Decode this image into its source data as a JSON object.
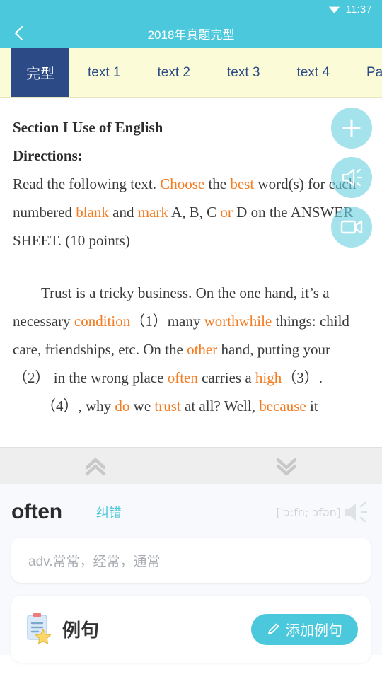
{
  "status_bar": {
    "time": "11:37",
    "wifi_icon": "wifi-icon"
  },
  "app_bar": {
    "back_icon": "back-chevron-icon",
    "title": "2018年真题完型"
  },
  "tabs": [
    {
      "label": "完型",
      "active": true
    },
    {
      "label": "text 1",
      "active": false
    },
    {
      "label": "text 2",
      "active": false
    },
    {
      "label": "text 3",
      "active": false
    },
    {
      "label": "text 4",
      "active": false
    },
    {
      "label": "Part I",
      "active": false
    }
  ],
  "fabs": [
    {
      "name": "add-button",
      "icon": "plus-icon"
    },
    {
      "name": "audio-button",
      "icon": "speaker-icon"
    },
    {
      "name": "video-button",
      "icon": "video-camera-icon"
    }
  ],
  "reader": {
    "section_title": "Section I  Use of English",
    "directions_label": "Directions:",
    "directions_line1_a": "Read the following text. ",
    "directions_choose": "Choose",
    "directions_line1_b": " the ",
    "directions_best": "best",
    "directions_line1_c": " word(s) for",
    "directions_line2_a": "each numbered ",
    "directions_blank": "blank",
    "directions_line2_b": " and ",
    "directions_mark": "mark",
    "directions_line2_c": " A, B, C ",
    "directions_or": "or",
    "directions_line2_d": " D on the",
    "directions_line3": "ANSWER SHEET. (10 points)",
    "para1_a": "Trust is a tricky business. On the one hand, it’s a necessary ",
    "para1_condition": "condition",
    "para1_b": "（1）many ",
    "para1_worthwhile": "worthwhile",
    "para1_c": " things: child care, friendships, etc. On the ",
    "para1_other": "other",
    "para1_d": " hand, putting your （2） in the wrong place ",
    "para1_often": "often",
    "para1_e": " carries a ",
    "para1_high": "high",
    "para1_f": "（3）.",
    "para2_a": "（4）, why ",
    "para2_do": "do",
    "para2_b": " we ",
    "para2_trust": "trust",
    "para2_c": " at all? Well, ",
    "para2_because": "because",
    "para2_d": " it"
  },
  "collapse_bar": {
    "up_icon": "double-chevron-up-icon",
    "down_icon": "double-chevron-down-icon"
  },
  "dictionary": {
    "word": "often",
    "report_error_label": "纠错",
    "phonetic": "[ˈɔ:fn; ɔfən]",
    "speaker_icon": "speaker-icon",
    "definition": "adv.常常，经常，通常"
  },
  "example_card": {
    "icon": "clipboard-star-icon",
    "title": "例句",
    "add_icon": "pencil-icon",
    "add_label": "添加例句"
  },
  "colors": {
    "header_teal": "#4cc8dd",
    "tab_strip_bg": "#fbfbd8",
    "tab_active_navy": "#2b4a86",
    "highlight_orange": "#f47b20",
    "fab_teal": "#9adde4",
    "collapse_bar_bg": "#eeeeee",
    "panel_bg": "#f7f9fc"
  }
}
